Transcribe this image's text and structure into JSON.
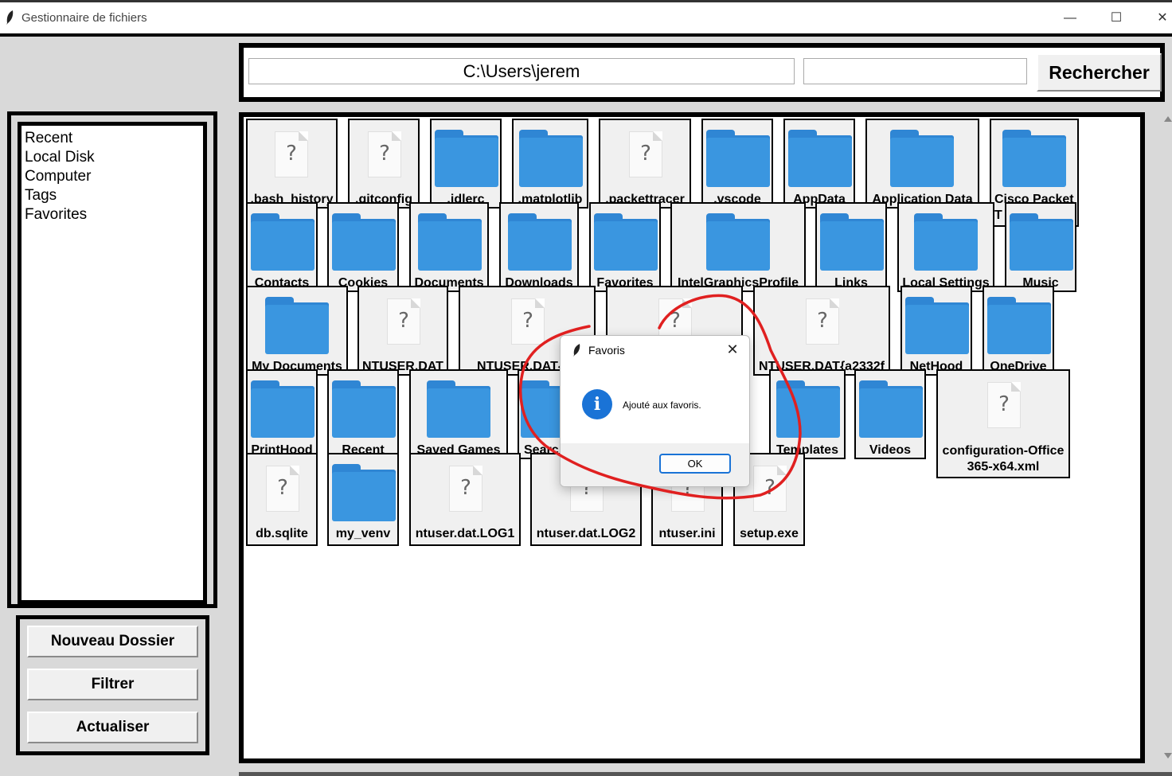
{
  "window": {
    "title": "Gestionnaire de fichiers",
    "minimize": "—",
    "maximize": "☐",
    "close": "✕"
  },
  "sidebar": {
    "items": [
      {
        "label": "Recent"
      },
      {
        "label": "Local Disk"
      },
      {
        "label": "Computer"
      },
      {
        "label": "Tags"
      },
      {
        "label": "Favorites"
      }
    ],
    "buttons": {
      "new_folder": "Nouveau Dossier",
      "filter": "Filtrer",
      "refresh": "Actualiser"
    }
  },
  "toolbar": {
    "path": "C:\\Users\\jerem",
    "search_value": "",
    "search_button": "Rechercher"
  },
  "files": {
    "bash_history": ".bash_history",
    "gitconfig": ".gitconfig",
    "idlerc": ".idlerc",
    "matplotlib": ".matplotlib",
    "packettracer": ".packettracer",
    "vscode": ".vscode",
    "appdata": "AppData",
    "application_data": "Application Data",
    "cisco": "Cisco Packet T",
    "contacts": "Contacts",
    "cookies": "Cookies",
    "documents": "Documents",
    "downloads": "Downloads",
    "favorites": "Favorites",
    "intel": "IntelGraphicsProfile",
    "links": "Links",
    "local_settings": "Local Settings",
    "music": "Music",
    "my_documents": "My Documents",
    "ntuser_dat": "NTUSER.DAT",
    "ntuser_dat_a": "NTUSER.DAT{a2",
    "ntuser_dat_b": "NTUSER.DAT{a2332f",
    "nethood": "NetHood",
    "onedrive": "OneDrive",
    "printhood": "PrintHood",
    "recent": "Recent",
    "saved_games": "Saved Games",
    "searches": "Searc",
    "templates": "Templates",
    "videos": "Videos",
    "config_office": "configuration-Office 365-x64.xml",
    "db_sqlite": "db.sqlite",
    "my_venv": "my_venv",
    "ntuser_log1": "ntuser.dat.LOG1",
    "ntuser_log2": "ntuser.dat.LOG2",
    "ntuser_ini": "ntuser.ini",
    "setup_exe": "setup.exe"
  },
  "dialog": {
    "title": "Favoris",
    "message": "Ajouté aux favoris.",
    "ok": "OK",
    "close": "✕",
    "icon": "info-icon"
  },
  "colors": {
    "folder": "#3a96e0",
    "annotation": "#e02020",
    "dialog_accent": "#1a73d6"
  }
}
